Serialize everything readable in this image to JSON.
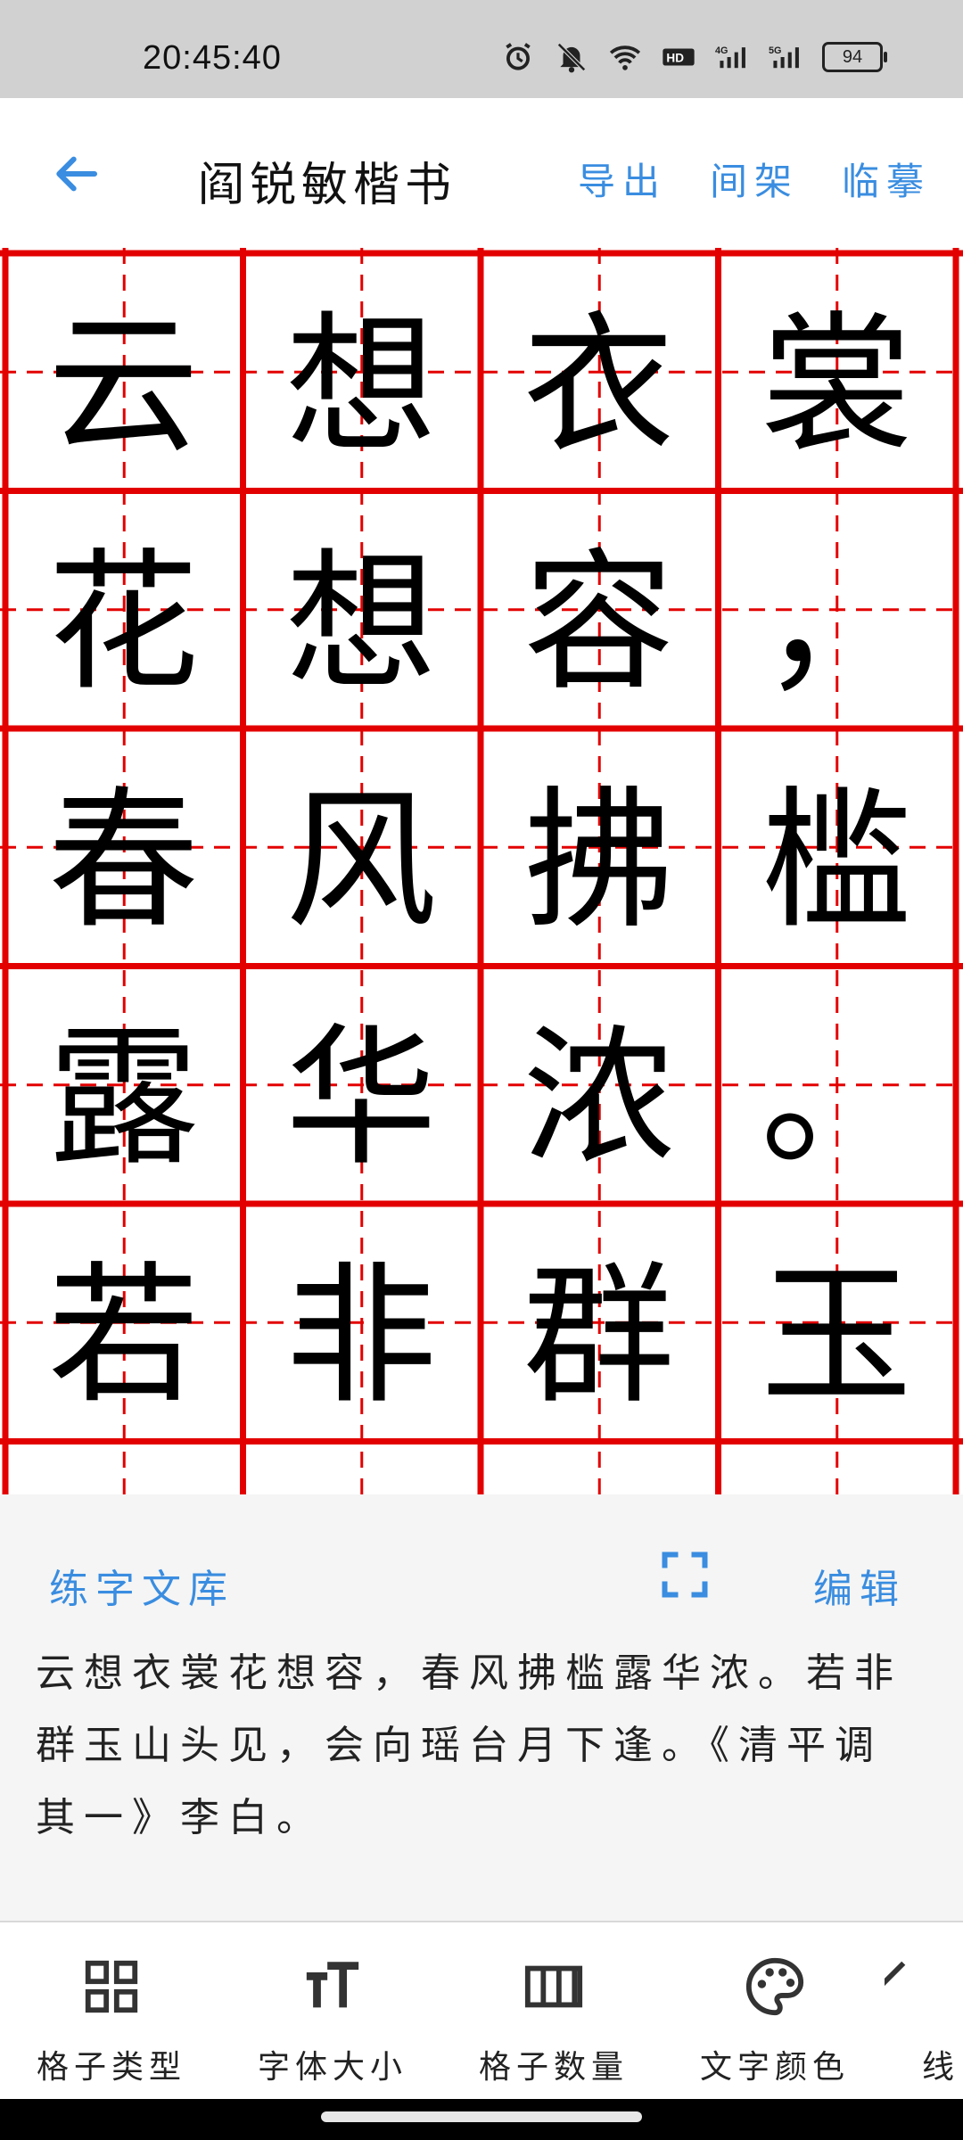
{
  "status_bar": {
    "time": "20:45:40",
    "icons": [
      "alarm-icon",
      "mute-icon",
      "wifi-icon",
      "hd-icon",
      "signal-4g-icon",
      "signal-5g-icon"
    ],
    "battery": "94"
  },
  "app_bar": {
    "title": "阎锐敏楷书",
    "actions": [
      "导出",
      "间架",
      "临摹"
    ],
    "accent_color": "#3a8de0"
  },
  "grid": {
    "grid_color": "#e30000",
    "characters": [
      [
        "云",
        "想",
        "衣",
        "裳"
      ],
      [
        "花",
        "想",
        "容",
        "，"
      ],
      [
        "春",
        "风",
        "拂",
        "槛"
      ],
      [
        "露",
        "华",
        "浓",
        "。"
      ],
      [
        "若",
        "非",
        "群",
        "玉"
      ]
    ]
  },
  "library": {
    "title": "练字文库",
    "edit_label": "编辑",
    "text_lines": [
      "云想衣裳花想容，春风拂槛露华浓。若非",
      "群玉山头见，会向瑶台月下逢。《清平调",
      "其一》李白。"
    ]
  },
  "bottom_nav": {
    "items": [
      {
        "label": "格子类型",
        "icon": "grid-type-icon"
      },
      {
        "label": "字体大小",
        "icon": "font-size-icon"
      },
      {
        "label": "格子数量",
        "icon": "grid-count-icon"
      },
      {
        "label": "文字颜色",
        "icon": "palette-icon"
      },
      {
        "label": "线",
        "icon": "line-icon"
      }
    ]
  }
}
